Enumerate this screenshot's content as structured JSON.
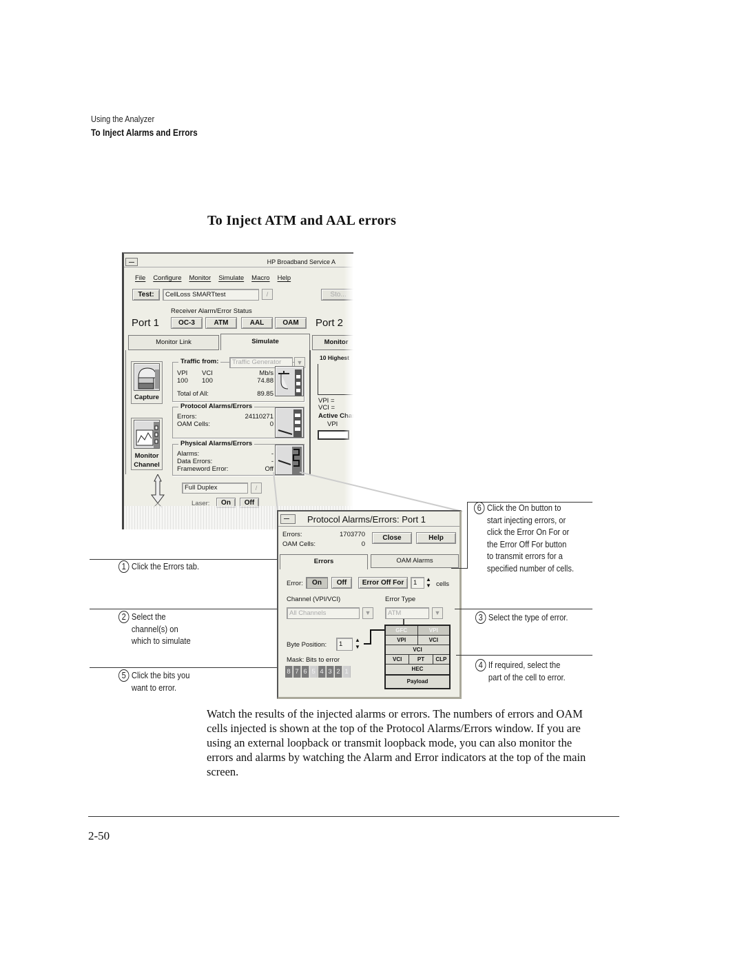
{
  "header": {
    "section": "Using the Analyzer",
    "subsection": "To Inject Alarms and Errors"
  },
  "title": "To Inject ATM and AAL errors",
  "main_window": {
    "title": "HP Broadband Service A",
    "menu": [
      "File",
      "Configure",
      "Monitor",
      "Simulate",
      "Macro",
      "Help"
    ],
    "test_label": "Test:",
    "test_value": "CellLoss SMARTtest",
    "stop_label": "Sto...",
    "status_heading": "Receiver Alarm/Error Status",
    "port1": "Port 1",
    "port2": "Port 2",
    "status_buttons": [
      "OC-3",
      "ATM",
      "AAL",
      "OAM"
    ],
    "tabs": [
      "Monitor Link",
      "Simulate",
      "Monitor"
    ],
    "side_buttons": {
      "capture": "Capture",
      "monitor_channel_1": "Monitor",
      "monitor_channel_2": "Channel"
    },
    "traffic": {
      "title": "Traffic from:",
      "source": "Traffic Generator",
      "col_vpi": "VPI",
      "col_vci": "VCI",
      "col_mbs": "Mb/s",
      "vpi": "100",
      "vci": "100",
      "mbs": "74.88",
      "total_label": "Total of All:",
      "total_value": "89.85"
    },
    "protocol": {
      "title": "Protocol Alarms/Errors",
      "errors_label": "Errors:",
      "errors_value": "24110271",
      "oam_label": "OAM Cells:",
      "oam_value": "0"
    },
    "physical": {
      "title": "Physical Alarms/Errors",
      "alarms_label": "Alarms:",
      "alarms_value": "-",
      "data_errors_label": "Data Errors:",
      "data_errors_value": "-",
      "frameword_label": "Frameword Error:",
      "frameword_value": "Off"
    },
    "right_panel": {
      "heading": "10 Highest",
      "vpi": "VPI =",
      "vci": "VCI =",
      "active": "Active Chan",
      "vpi_col": "VPI"
    },
    "duplex": "Full Duplex",
    "laser_label": "Laser:",
    "laser_on": "On",
    "laser_off": "Off"
  },
  "popup": {
    "title": "Protocol Alarms/Errors: Port 1",
    "errors_label": "Errors:",
    "errors_value": "1703770",
    "oam_label": "OAM Cells:",
    "oam_value": "0",
    "close": "Close",
    "help": "Help",
    "tabs": [
      "Errors",
      "OAM Alarms"
    ],
    "error_label": "Error:",
    "on": "On",
    "off": "Off",
    "error_off_for": "Error Off For",
    "cells_value": "1",
    "cells_label": "cells",
    "channel_label": "Channel (VPI/VCI)",
    "channel_value": "All Channels",
    "error_type_label": "Error Type",
    "error_type_value": "ATM",
    "byte_position_label": "Byte Position:",
    "byte_position_value": "1",
    "mask_label": "Mask: Bits to error",
    "mask_bits": [
      {
        "label": "8",
        "selected": true
      },
      {
        "label": "7",
        "selected": true
      },
      {
        "label": "6",
        "selected": true
      },
      {
        "label": "5",
        "selected": false
      },
      {
        "label": "4",
        "selected": true
      },
      {
        "label": "3",
        "selected": true
      },
      {
        "label": "2",
        "selected": true
      },
      {
        "label": "1",
        "selected": false
      }
    ],
    "cell_header": [
      [
        "GFC",
        "VPI"
      ],
      [
        "VPI",
        "VCI"
      ],
      [
        "VCI"
      ],
      [
        "VCI",
        "PT",
        "CLP"
      ],
      [
        "HEC"
      ]
    ],
    "payload": "Payload"
  },
  "callouts": [
    {
      "n": "1",
      "text": "Click the Errors tab."
    },
    {
      "n": "2",
      "text": "Select the\nchannel(s) on\nwhich to simulate"
    },
    {
      "n": "5",
      "text": "Click the bits you\nwant to error."
    },
    {
      "n": "6",
      "text": "Click the On button to\nstart injecting errors, or\nclick the Error On For or\nthe Error Off For button\nto transmit errors for a\nspecified number of cells."
    },
    {
      "n": "3",
      "text": "Select the type of error."
    },
    {
      "n": "4",
      "text": "If required, select the\npart of the cell to error."
    }
  ],
  "body": "Watch the results of the injected alarms or errors. The numbers of errors and OAM cells injected is shown at the top of the Protocol Alarms/Errors window. If you are using an external loopback or transmit loopback mode, you can also monitor the errors and alarms by watching the Alarm and Error indicators at the top of the main screen.",
  "page_number": "2-50"
}
